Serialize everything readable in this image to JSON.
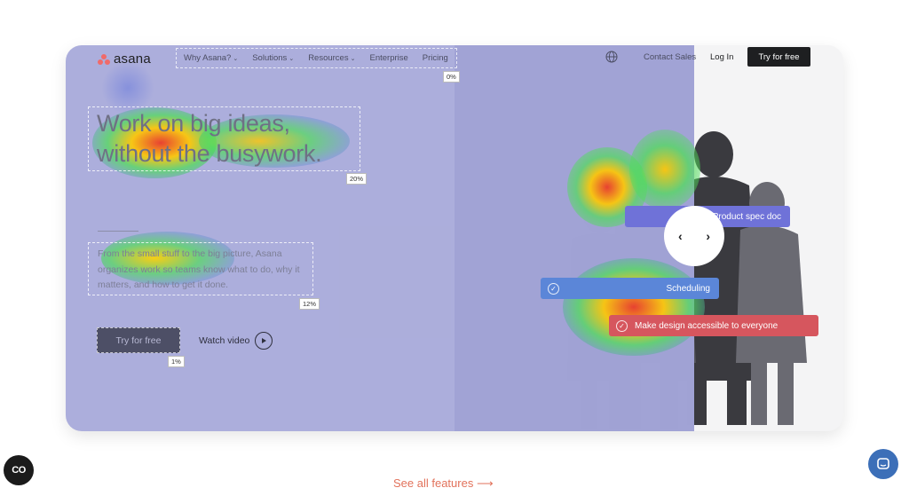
{
  "nav": {
    "logo_text": "asana",
    "items": [
      {
        "label": "Why Asana?",
        "has_dropdown": true
      },
      {
        "label": "Solutions",
        "has_dropdown": true
      },
      {
        "label": "Resources",
        "has_dropdown": true
      },
      {
        "label": "Enterprise",
        "has_dropdown": false
      },
      {
        "label": "Pricing",
        "has_dropdown": false
      }
    ],
    "contact_sales": "Contact Sales",
    "log_in": "Log In",
    "try_free": "Try for free",
    "click_pct": "0%"
  },
  "hero": {
    "headline_line1": "Work on big ideas,",
    "headline_line2": "without the busywork.",
    "headline_pct": "20%",
    "subtext": "From the small stuff to the big picture, Asana organizes work so teams know what to do, why it matters, and how to get it done.",
    "subtext_pct": "12%",
    "cta_label": "Try for free",
    "cta_pct": "1%",
    "watch_video": "Watch video"
  },
  "tasks": [
    {
      "label": "Product spec doc",
      "color": "#6f72d8"
    },
    {
      "label": "Scheduling",
      "color": "#5b86d8"
    },
    {
      "label": "Make design accessible to everyone",
      "color": "#d6565e"
    }
  ],
  "carousel": {
    "prev": "‹",
    "next": "›"
  },
  "footer": {
    "see_all": "See all features ⟶",
    "feedback_icon": "CO"
  },
  "colors": {
    "overlay": "#a8aada",
    "brand_coral": "#f06a6a",
    "link_orange": "#e2725b",
    "chat_blue": "#3c6fb8"
  }
}
